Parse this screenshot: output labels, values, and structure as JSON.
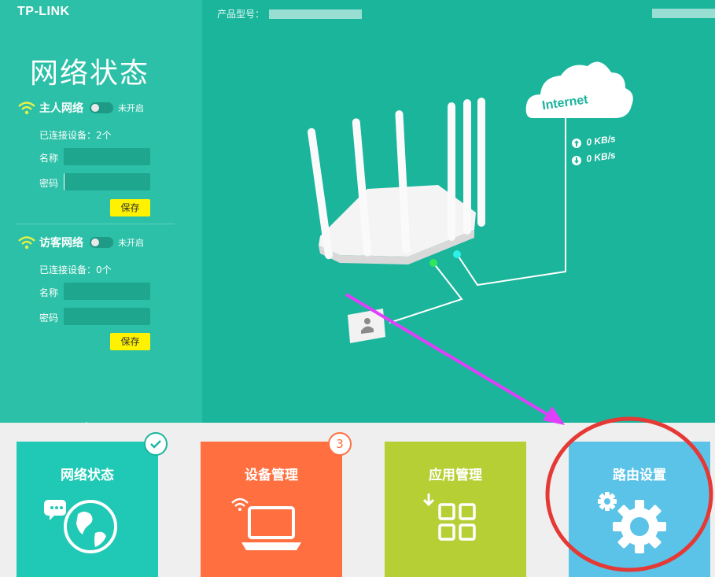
{
  "brand": {
    "logo": "TP-LINK"
  },
  "header": {
    "model_label": "产品型号："
  },
  "sidebar": {
    "title": "网络状态",
    "host_network": {
      "title": "主人网络",
      "status": "未开启",
      "connected": "已连接设备：2个",
      "name_label": "名称",
      "name_value": "",
      "password_label": "密码",
      "password_value": "",
      "save_label": "保存"
    },
    "guest_network": {
      "title": "访客网络",
      "status": "未开启",
      "connected": "已连接设备：0个",
      "name_label": "名称",
      "name_value": "",
      "password_label": "密码",
      "password_value": "",
      "save_label": "保存"
    }
  },
  "diagram": {
    "internet_label": "Internet",
    "upload_speed": "0 KB/s",
    "download_speed": "0 KB/s"
  },
  "tiles": [
    {
      "label": "网络状态",
      "color": "#1fc9b5",
      "icon": "globe-icon"
    },
    {
      "label": "设备管理",
      "color": "#ff6f40",
      "icon": "laptop-icon",
      "badge": "3"
    },
    {
      "label": "应用管理",
      "color": "#b6cf34",
      "icon": "apps-grid-icon"
    },
    {
      "label": "路由设置",
      "color": "#5bc2e8",
      "icon": "gear-icon"
    }
  ],
  "colors": {
    "teal_bg": "#1bb59c",
    "teal_panel": "#2bc0a7",
    "save_yellow": "#fff200",
    "annotation_arrow": "#e040fb",
    "annotation_circle": "#e53935"
  }
}
